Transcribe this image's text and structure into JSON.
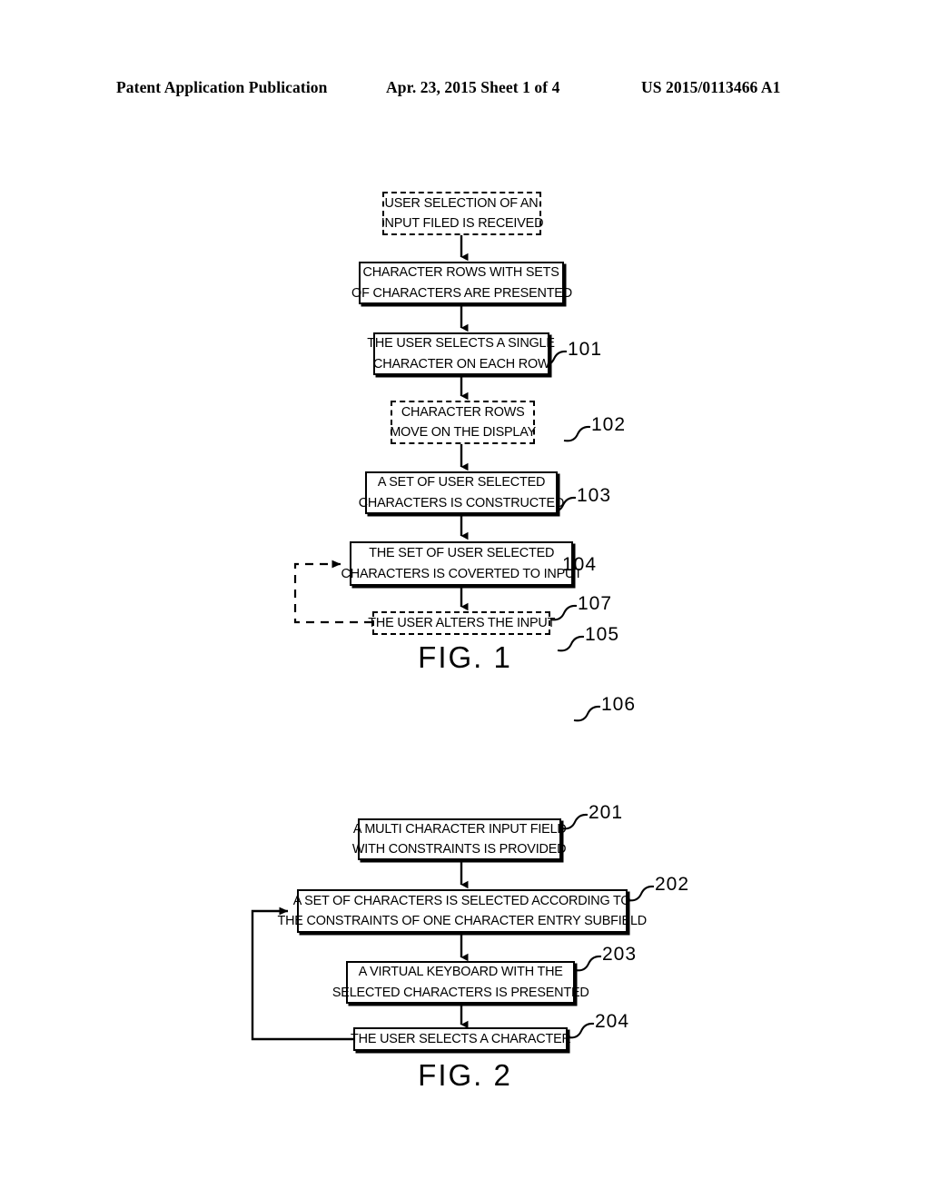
{
  "header": {
    "publication": "Patent Application Publication",
    "date_sheet": "Apr. 23, 2015  Sheet 1 of 4",
    "patent_number": "US 2015/0113466 A1"
  },
  "figures": [
    {
      "caption": "FIG. 1",
      "nodes": [
        {
          "ref": "101",
          "style": "dashed",
          "lines": [
            "USER SELECTION OF AN",
            "INPUT FILED IS RECEIVED"
          ]
        },
        {
          "ref": "102",
          "style": "solid",
          "lines": [
            "CHARACTER ROWS WITH SETS",
            "OF CHARACTERS ARE PRESENTED"
          ]
        },
        {
          "ref": "103",
          "style": "solid",
          "lines": [
            "THE USER SELECTS A SINGLE",
            "CHARACTER ON EACH ROW"
          ]
        },
        {
          "ref": "104",
          "style": "dashed",
          "lines": [
            "CHARACTER ROWS",
            "MOVE ON THE DISPLAY"
          ]
        },
        {
          "ref": "105",
          "style": "solid",
          "lines": [
            "A SET OF USER SELECTED",
            "CHARACTERS IS CONSTRUCTED"
          ]
        },
        {
          "ref": "106",
          "style": "solid",
          "lines": [
            "THE SET OF USER SELECTED",
            "CHARACTERS IS COVERTED TO INPUT"
          ]
        },
        {
          "ref": "107",
          "style": "dashed",
          "lines": [
            "THE USER ALTERS THE INPUT"
          ]
        }
      ],
      "feedback_loop": {
        "from": "107",
        "to": "106",
        "style": "dashed"
      }
    },
    {
      "caption": "FIG. 2",
      "nodes": [
        {
          "ref": "201",
          "style": "solid",
          "lines": [
            "A MULTI CHARACTER INPUT FIELD",
            "WITH CONSTRAINTS IS PROVIDED"
          ]
        },
        {
          "ref": "202",
          "style": "solid",
          "lines": [
            "A SET OF CHARACTERS IS SELECTED ACCORDING TO",
            "THE CONSTRAINTS OF ONE CHARACTER ENTRY SUBFIELD"
          ]
        },
        {
          "ref": "203",
          "style": "solid",
          "lines": [
            "A VIRTUAL KEYBOARD WITH THE",
            "SELECTED CHARACTERS IS PRESENTED"
          ]
        },
        {
          "ref": "204",
          "style": "solid",
          "lines": [
            "THE USER SELECTS A CHARACTER"
          ]
        }
      ],
      "feedback_loop": {
        "from": "204",
        "to": "202",
        "style": "solid"
      }
    }
  ],
  "colors": {
    "ink": "#000000",
    "page": "#ffffff"
  }
}
